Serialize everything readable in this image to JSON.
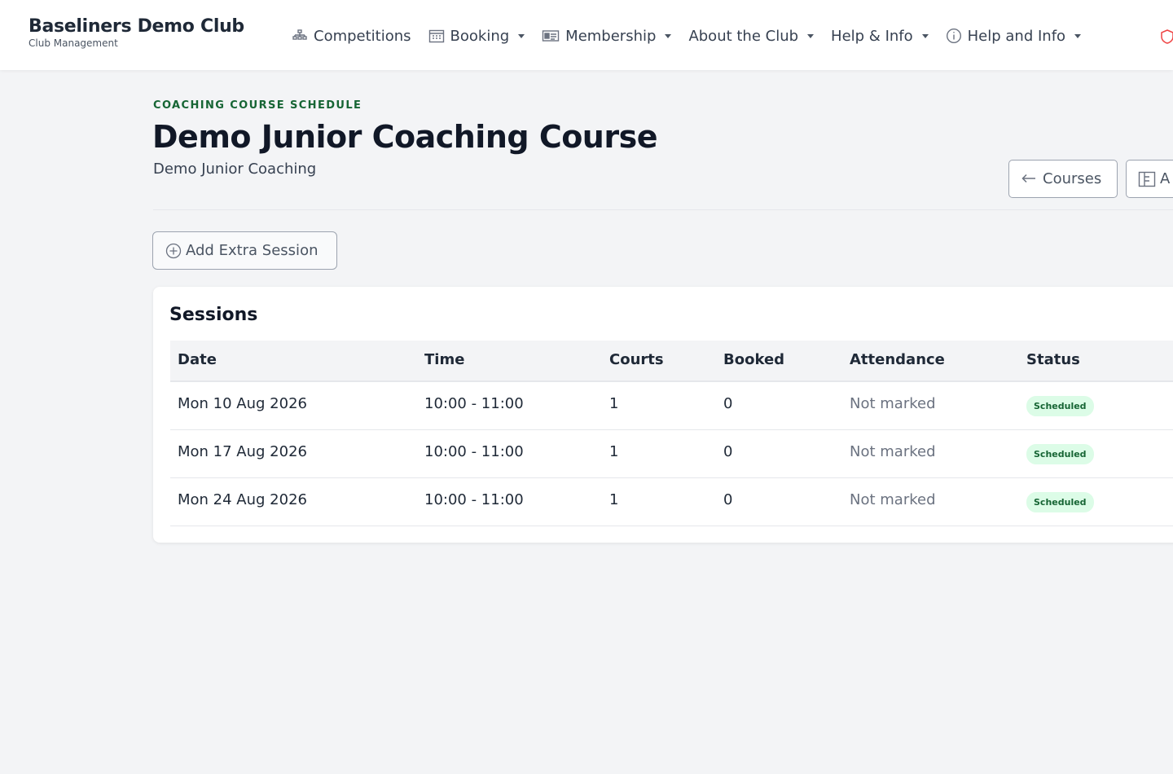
{
  "brand": {
    "name": "Baseliners Demo Club",
    "subtitle": "Club Management"
  },
  "nav": {
    "items": [
      {
        "label": "Competitions",
        "icon": "bracket-icon",
        "dropdown": false
      },
      {
        "label": "Booking",
        "icon": "calendar-icon",
        "dropdown": true
      },
      {
        "label": "Membership",
        "icon": "id-card-icon",
        "dropdown": true
      },
      {
        "label": "About the Club",
        "icon": "",
        "dropdown": true
      },
      {
        "label": "Help & Info",
        "icon": "",
        "dropdown": true
      },
      {
        "label": "Help and Info",
        "icon": "info-circle-icon",
        "dropdown": true
      }
    ]
  },
  "header": {
    "eyebrow": "Coaching Course Schedule",
    "title": "Demo Junior Coaching Course",
    "subtitle": "Demo Junior Coaching",
    "courses_button": "Courses",
    "second_button": "A"
  },
  "actions": {
    "add_session": "Add Extra Session"
  },
  "sessions": {
    "title": "Sessions",
    "columns": [
      "Date",
      "Time",
      "Courts",
      "Booked",
      "Attendance",
      "Status"
    ],
    "rows": [
      {
        "date": "Mon 10 Aug 2026",
        "time": "10:00 - 11:00",
        "courts": "1",
        "booked": "0",
        "attendance": "Not marked",
        "status": "Scheduled"
      },
      {
        "date": "Mon 17 Aug 2026",
        "time": "10:00 - 11:00",
        "courts": "1",
        "booked": "0",
        "attendance": "Not marked",
        "status": "Scheduled"
      },
      {
        "date": "Mon 24 Aug 2026",
        "time": "10:00 - 11:00",
        "courts": "1",
        "booked": "0",
        "attendance": "Not marked",
        "status": "Scheduled"
      }
    ]
  },
  "colors": {
    "accent": "#166534",
    "badge_bg": "#dcfce7",
    "page_bg": "#f3f4f6"
  }
}
